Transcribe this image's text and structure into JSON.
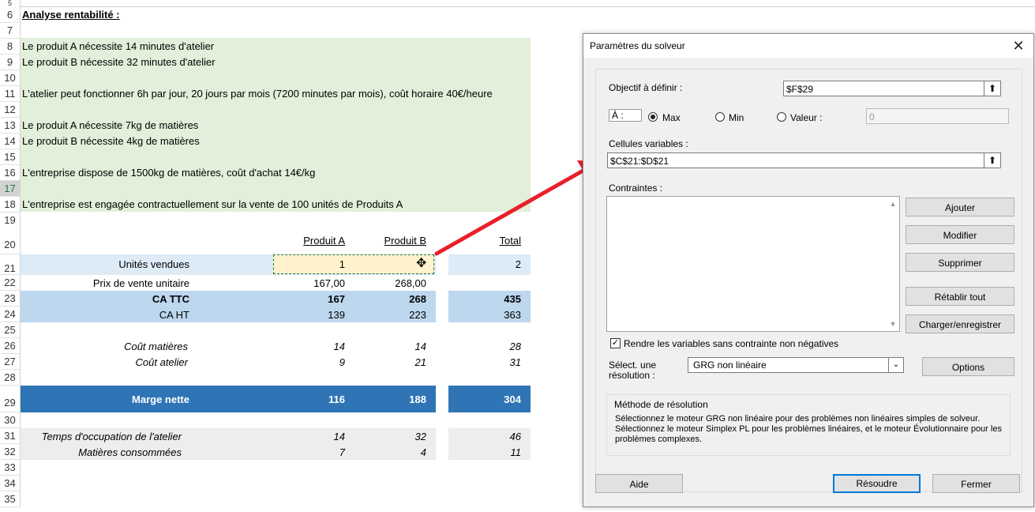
{
  "sheet": {
    "row_numbers": [
      "6",
      "7",
      "8",
      "9",
      "10",
      "11",
      "12",
      "13",
      "14",
      "15",
      "16",
      "17",
      "18",
      "19",
      "20",
      "21",
      "22",
      "23",
      "24",
      "25",
      "26",
      "27",
      "28",
      "29",
      "30",
      "31",
      "32",
      "33",
      "34",
      "35"
    ],
    "row5_partial": "5",
    "title": "Analyse rentabilité :",
    "notes": {
      "r8": "Le produit A nécessite 14 minutes d'atelier",
      "r9": "Le produit B nécessite 32 minutes d'atelier",
      "r11": "L'atelier peut fonctionner 6h par jour, 20 jours par mois (7200 minutes par mois), coût horaire 40€/heure",
      "r13": "Le produit A nécessite 7kg de matières",
      "r14": "Le produit B nécessite 4kg de matières",
      "r16": "L'entreprise dispose de 1500kg de matières, coût d'achat 14€/kg",
      "r18": "L'entreprise est engagée contractuellement sur la vente de 100 unités de Produits A"
    },
    "headers": {
      "a": "Produit A",
      "b": "Produit B",
      "total": "Total"
    },
    "rows": {
      "units": {
        "label": "Unités vendues",
        "a": "1",
        "b": "",
        "total": "2"
      },
      "price": {
        "label": "Prix de vente unitaire",
        "a": "167,00",
        "b": "268,00"
      },
      "ca_ttc": {
        "label": "CA TTC",
        "a": "167",
        "b": "268",
        "total": "435"
      },
      "ca_ht": {
        "label": "CA HT",
        "a": "139",
        "b": "223",
        "total": "363"
      },
      "cout_mat": {
        "label": "Coût matières",
        "a": "14",
        "b": "14",
        "total": "28"
      },
      "cout_atelier": {
        "label": "Coût atelier",
        "a": "9",
        "b": "21",
        "total": "31"
      },
      "marge": {
        "label": "Marge nette",
        "a": "116",
        "b": "188",
        "total": "304"
      },
      "temps": {
        "label": "Temps d'occupation de l'atelier",
        "a": "14",
        "b": "32",
        "total": "46"
      },
      "matieres": {
        "label": "Matières consommées",
        "a": "7",
        "b": "4",
        "total": "11"
      }
    },
    "colors": {
      "green_fill": "#e2efda",
      "light_blue": "#ddebf7",
      "mid_blue": "#bdd7ee",
      "dark_blue": "#2f75b5",
      "grey": "#ededed",
      "selected_cell": "#fff2cc",
      "arrow": "#e8202a"
    }
  },
  "dialog": {
    "title": "Paramètres du solveur",
    "close_icon": "close-icon",
    "objective_label": "Objectif à définir :",
    "objective_value": "$F$29",
    "to_label": "À :",
    "max_label": "Max",
    "min_label": "Min",
    "value_label": "Valeur :",
    "value_input": "0",
    "variables_label": "Cellules variables :",
    "variables_value": "$C$21:$D$21",
    "constraints_label": "Contraintes :",
    "buttons": {
      "add": "Ajouter",
      "modify": "Modifier",
      "delete": "Supprimer",
      "reset": "Rétablir tout",
      "load_save": "Charger/enregistrer",
      "options": "Options",
      "help": "Aide",
      "solve": "Résoudre",
      "close": "Fermer"
    },
    "nonneg_label": "Rendre les variables sans contrainte non négatives",
    "select_label_1": "Sélect. une",
    "select_label_2": "résolution :",
    "select_value": "GRG non linéaire",
    "method_title": "Méthode de résolution",
    "method_desc": "Sélectionnez le moteur GRG non linéaire pour des problèmes non linéaires simples de solveur. Sélectionnez le moteur Simplex PL pour les problèmes linéaires, et le moteur Évolutionnaire pour les problèmes complexes."
  }
}
